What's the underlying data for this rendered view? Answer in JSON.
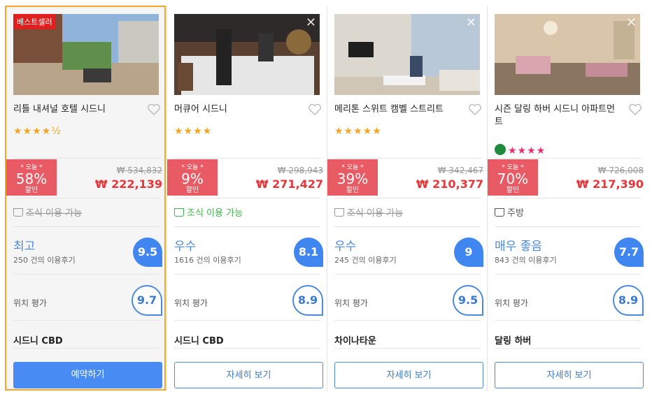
{
  "colors": {
    "accent": "#488bf2",
    "highlight": "#f5a623",
    "discount": "#e85a64",
    "price": "#e8353a",
    "breakfast_on": "#3cb54a"
  },
  "common": {
    "today_label": "* 오늘 *",
    "off_label": "할인",
    "location_label": "위치 평가"
  },
  "hotels": [
    {
      "badge": "베스트셀러",
      "name": "리틀 내셔널 호텔 시드니",
      "stars": "★★★★½",
      "discount_pct": "58%",
      "price_old": "₩ 534,832",
      "price_new": "₩ 222,139",
      "amenity": "조식 이용 가능",
      "rating_word": "최고",
      "reviews": "250 건의 이용후기",
      "score": "9.5",
      "location_score": "9.7",
      "area": "시드니 CBD",
      "button": "예약하기"
    },
    {
      "name": "머큐어 시드니",
      "stars": "★★★★",
      "discount_pct": "9%",
      "price_old": "₩ 298,943",
      "price_new": "₩ 271,427",
      "amenity": "조식 이용 가능",
      "rating_word": "우수",
      "reviews": "1616 건의 이용후기",
      "score": "8.1",
      "location_score": "8.9",
      "area": "시드니 CBD",
      "button": "자세히 보기"
    },
    {
      "name": "메리톤 스위트 캠벨 스트리트",
      "stars": "★★★★★",
      "discount_pct": "39%",
      "price_old": "₩ 342,467",
      "price_new": "₩ 210,377",
      "amenity": "조식 이용 가능",
      "rating_word": "우수",
      "reviews": "245 건의 이용후기",
      "score": "9",
      "location_score": "9.5",
      "area": "차이나타운",
      "button": "자세히 보기"
    },
    {
      "name": "시즌 달링 하버 시드니 아파트먼트",
      "stars": "★★★★",
      "discount_pct": "70%",
      "price_old": "₩ 726,008",
      "price_new": "₩ 217,390",
      "amenity": "주방",
      "rating_word": "매우 좋음",
      "reviews": "843 건의 이용후기",
      "score": "7.7",
      "location_score": "8.9",
      "area": "달링 하버",
      "button": "자세히 보기"
    }
  ]
}
